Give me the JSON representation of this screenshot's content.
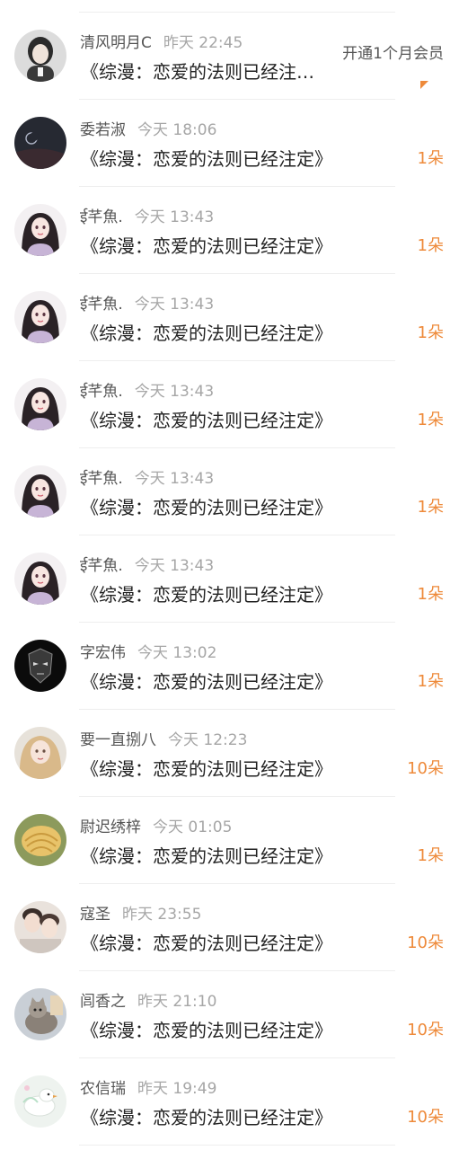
{
  "feed": {
    "items": [
      {
        "user": "清风明月C",
        "time": "昨天 22:45",
        "title": "《综漫：恋爱的法则已经注…",
        "promo": "开通1个月会员",
        "avatar": "dark-hair-portrait"
      },
      {
        "user": "委若淑",
        "time": "今天 18:06",
        "title": "《综漫：恋爱的法则已经注定》",
        "gift": "1朵",
        "avatar": "moon-night-sky"
      },
      {
        "user": "ई芊魚.",
        "time": "今天 13:43",
        "title": "《综漫：恋爱的法则已经注定》",
        "gift": "1朵",
        "avatar": "anime-girl"
      },
      {
        "user": "ई芊魚.",
        "time": "今天 13:43",
        "title": "《综漫：恋爱的法则已经注定》",
        "gift": "1朵",
        "avatar": "anime-girl"
      },
      {
        "user": "ई芊魚.",
        "time": "今天 13:43",
        "title": "《综漫：恋爱的法则已经注定》",
        "gift": "1朵",
        "avatar": "anime-girl"
      },
      {
        "user": "ई芊魚.",
        "time": "今天 13:43",
        "title": "《综漫：恋爱的法则已经注定》",
        "gift": "1朵",
        "avatar": "anime-girl"
      },
      {
        "user": "ई芊魚.",
        "time": "今天 13:43",
        "title": "《综漫：恋爱的法则已经注定》",
        "gift": "1朵",
        "avatar": "anime-girl"
      },
      {
        "user": "字宏伟",
        "time": "今天 13:02",
        "title": "《综漫：恋爱的法则已经注定》",
        "gift": "1朵",
        "avatar": "dark-mask"
      },
      {
        "user": "要一直捌八",
        "time": "今天 12:23",
        "title": "《综漫：恋爱的法则已经注定》",
        "gift": "10朵",
        "avatar": "blonde-girl"
      },
      {
        "user": "尉迟绣梓",
        "time": "今天 01:05",
        "title": "《综漫：恋爱的法则已经注定》",
        "gift": "1朵",
        "avatar": "seashell"
      },
      {
        "user": "寇圣",
        "time": "昨天 23:55",
        "title": "《综漫：恋爱的法则已经注定》",
        "gift": "10朵",
        "avatar": "two-people"
      },
      {
        "user": "闾香之",
        "time": "昨天 21:10",
        "title": "《综漫：恋爱的法则已经注定》",
        "gift": "10朵",
        "avatar": "cat"
      },
      {
        "user": "农信瑞",
        "time": "昨天 19:49",
        "title": "《综漫：恋爱的法则已经注定》",
        "gift": "10朵",
        "avatar": "white-bird"
      }
    ]
  },
  "colors": {
    "gift": "#ee8a3a",
    "username": "#555555",
    "timestamp": "#a6a6a6",
    "title": "#222222",
    "divider": "#eeeeee"
  }
}
